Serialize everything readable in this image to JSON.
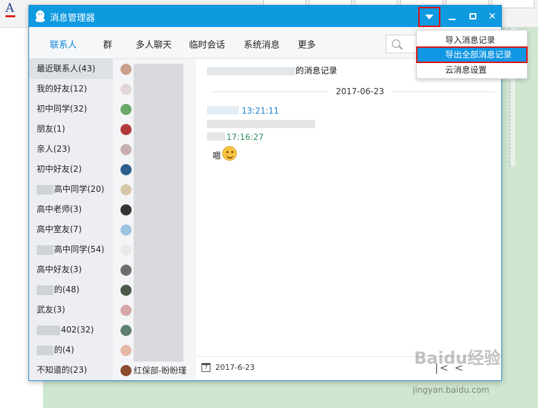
{
  "window": {
    "title": "消息管理器"
  },
  "nav": {
    "tabs": [
      "联系人",
      "群",
      "多人聊天",
      "临时会话",
      "系统消息",
      "更多"
    ]
  },
  "groups": [
    {
      "label": "最近联系人(43)"
    },
    {
      "label": "我的好友(12)"
    },
    {
      "label": "初中同学(32)"
    },
    {
      "label": "朋友(1)"
    },
    {
      "label": "亲人(23)"
    },
    {
      "label": "初中好友(2)"
    },
    {
      "label": "高中同学(20)",
      "blurred_prefix": true
    },
    {
      "label": "高中老师(3)"
    },
    {
      "label": "高中室友(7)"
    },
    {
      "label": "高中同学(54)",
      "blurred_prefix": true
    },
    {
      "label": "高中好友(3)"
    },
    {
      "label": "的(48)",
      "blurred_prefix": true
    },
    {
      "label": "武友(3)"
    },
    {
      "label": "402(32)",
      "blurred_prefix": true
    },
    {
      "label": "的(4)",
      "blurred_prefix": true
    },
    {
      "label": "不知道的(23)"
    }
  ],
  "contacts": {
    "last_label": "红保部-盼盼瑾"
  },
  "messages": {
    "header_suffix": "的消息记录",
    "date_separator": "2017-06-23",
    "time1": "13:21:11",
    "time2": "17:16:27",
    "text": "嗯"
  },
  "footer": {
    "date": "2017-6-23",
    "pager": "|< <"
  },
  "menu": {
    "items": [
      "导入消息记录",
      "导出全部消息记录",
      "云消息设置"
    ],
    "highlighted": 1
  },
  "watermark": {
    "brand": "Baidu经验",
    "url": "jingyan.baidu.com"
  },
  "colors": {
    "titlebar": "#0f9ae0",
    "accent": "#0a86d8",
    "highlight_box": "#e01010"
  }
}
